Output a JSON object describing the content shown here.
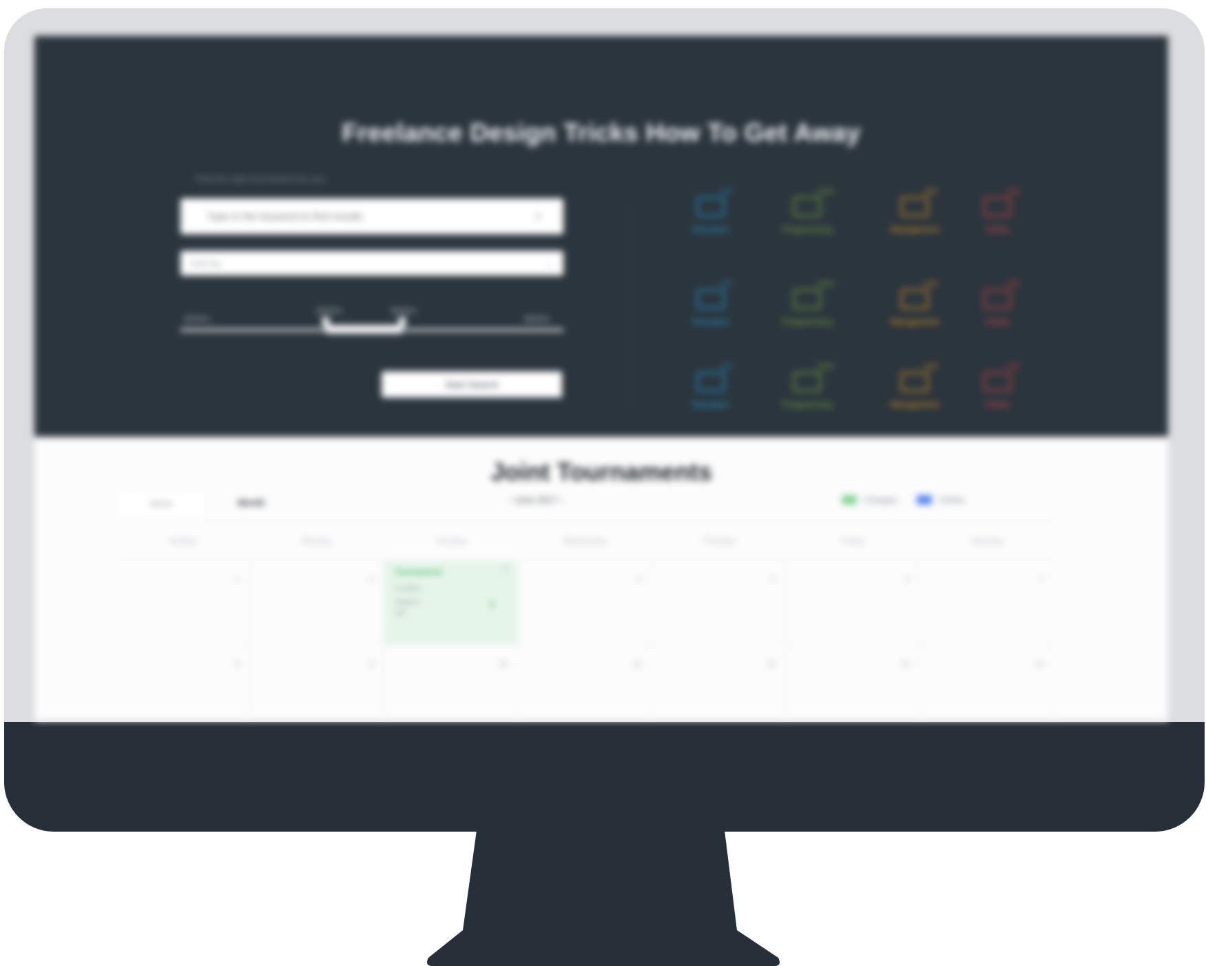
{
  "hero": {
    "title": "Freelance Design Tricks How To Get Away",
    "search_hint": "Find the right tournament for you",
    "search_placeholder": "Type in the keyword to find results",
    "select_value": "Sort by",
    "range": {
      "labels": [
        "$100m",
        "$200m",
        "$300m",
        "$500m"
      ],
      "fill_start": 0.38,
      "fill_end": 0.58
    },
    "start_button": "Start Search"
  },
  "categories": [
    {
      "label": "Education",
      "count": "127",
      "color": "#1ea7e4"
    },
    {
      "label": "Programming",
      "count": "1254",
      "color": "#7fba3c"
    },
    {
      "label": "Management",
      "count": "215",
      "color": "#f3a11b"
    },
    {
      "label": "Hobby",
      "count": "153",
      "color": "#e84545"
    },
    {
      "label": "Education",
      "count": "127",
      "color": "#1ea7e4"
    },
    {
      "label": "Programming",
      "count": "1254",
      "color": "#7fba3c"
    },
    {
      "label": "Management",
      "count": "215",
      "color": "#f3a11b"
    },
    {
      "label": "Hobby",
      "count": "153",
      "color": "#e84545"
    },
    {
      "label": "Education",
      "count": "127",
      "color": "#1ea7e4"
    },
    {
      "label": "Programming",
      "count": "1254",
      "color": "#7fba3c"
    },
    {
      "label": "Management",
      "count": "215",
      "color": "#f3a11b"
    },
    {
      "label": "Hobby",
      "count": "153",
      "color": "#e84545"
    }
  ],
  "tournaments": {
    "title": "Joint Tournaments",
    "tabs": [
      "Week",
      "Month"
    ],
    "month": "June 2017",
    "legend": [
      {
        "label": "Charges",
        "color": "#7ed38f"
      },
      {
        "label": "Online",
        "color": "#4f7ff0"
      }
    ],
    "weekdays": [
      "Sunday",
      "Monday",
      "Tuesday",
      "Wednesday",
      "Thursday",
      "Friday",
      "Saturday"
    ],
    "row1_dates": [
      "1",
      "2",
      "3",
      "4",
      "5",
      "6",
      "7"
    ],
    "row2_dates": [
      "8",
      "9",
      "10",
      "11",
      "12",
      "13",
      "14"
    ],
    "event": {
      "title": "Tournament",
      "date": "3",
      "line1": "Location",
      "line2": "Stadium",
      "line3": "Info"
    }
  },
  "colors": {
    "monitor_body": "#273038",
    "hero_bg": "#2b353d",
    "event_bg": "#e6f5ea"
  }
}
